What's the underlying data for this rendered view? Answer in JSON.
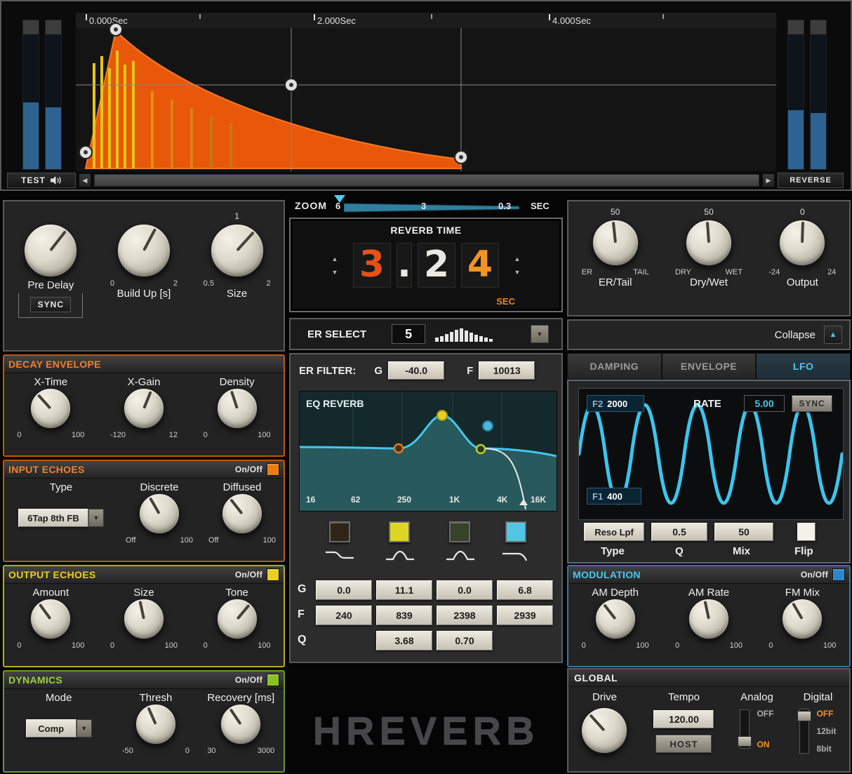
{
  "icons": {
    "up_triangle": "▲",
    "down_triangle": "▼",
    "left_arrow": "◀",
    "right_arrow": "▶"
  },
  "top": {
    "time_labels": [
      "0.000Sec",
      "2.000Sec",
      "4.000Sec"
    ],
    "test": "TEST",
    "reverse": "REVERSE"
  },
  "zoom": {
    "label": "ZOOM",
    "left": "6",
    "mid": "3",
    "right": "0.3",
    "unit": "SEC"
  },
  "left": {
    "pre_delay": {
      "label": "Pre Delay",
      "sync": "SYNC"
    },
    "build_up": {
      "label": "Build Up [s]",
      "min": "0",
      "max": "2"
    },
    "size": {
      "label": "Size",
      "value": "1",
      "min": "0.5",
      "max": "2"
    },
    "decay": {
      "title": "DECAY ENVELOPE",
      "knobs": [
        {
          "label": "X-Time",
          "min": "0",
          "max": "100"
        },
        {
          "label": "X-Gain",
          "min": "-120",
          "max": "12"
        },
        {
          "label": "Density",
          "min": "0",
          "max": "100"
        }
      ]
    },
    "input_echoes": {
      "title": "INPUT ECHOES",
      "onoff": "On/Off",
      "type_label": "Type",
      "type_value": "6Tap 8th FB",
      "knobs": [
        {
          "label": "Discrete",
          "min": "Off",
          "max": "100"
        },
        {
          "label": "Diffused",
          "min": "Off",
          "max": "100"
        }
      ]
    },
    "output_echoes": {
      "title": "OUTPUT ECHOES",
      "onoff": "On/Off",
      "knobs": [
        {
          "label": "Amount",
          "min": "0",
          "max": "100"
        },
        {
          "label": "Size",
          "min": "0",
          "max": "100"
        },
        {
          "label": "Tone",
          "min": "0",
          "max": "100"
        }
      ]
    },
    "dynamics": {
      "title": "DYNAMICS",
      "onoff": "On/Off",
      "mode_label": "Mode",
      "mode_value": "Comp",
      "knobs": [
        {
          "label": "Thresh",
          "min": "-50",
          "max": "0"
        },
        {
          "label": "Recovery [ms]",
          "min": "30",
          "max": "3000"
        }
      ]
    }
  },
  "center": {
    "reverb_time": {
      "title": "REVERB TIME",
      "d1": "3",
      "d2": ".",
      "d3": "2",
      "d4": "4",
      "unit": "SEC"
    },
    "er_select": {
      "label": "ER SELECT",
      "value": "5"
    },
    "er_filter": {
      "label": "ER FILTER:",
      "g": "G",
      "g_value": "-40.0",
      "f": "F",
      "f_value": "10013"
    },
    "eq": {
      "title": "EQ REVERB",
      "freqs": [
        "16",
        "62",
        "250",
        "1K",
        "4K",
        "16K"
      ]
    },
    "grid": {
      "g": "G",
      "f": "F",
      "q": "Q",
      "g_values": [
        "0.0",
        "11.1",
        "0.0",
        "6.8"
      ],
      "f_values": [
        "240",
        "839",
        "2398",
        "2939"
      ],
      "q_values": [
        "3.68",
        "0.70"
      ]
    },
    "logo": "HREVERB"
  },
  "right": {
    "er_tail": {
      "label": "ER/Tail",
      "value": "50",
      "min": "ER",
      "max": "TAIL"
    },
    "dry_wet": {
      "label": "Dry/Wet",
      "value": "50",
      "min": "DRY",
      "max": "WET"
    },
    "output": {
      "label": "Output",
      "value": "0",
      "min": "-24",
      "max": "24"
    },
    "collapse": "Collapse",
    "tabs": [
      "DAMPING",
      "ENVELOPE",
      "LFO"
    ],
    "lfo": {
      "f2": "F2",
      "f2_value": "2000",
      "rate": "RATE",
      "rate_value": "5.00",
      "sync": "SYNC",
      "f1": "F1",
      "f1_value": "400",
      "type_value": "Reso Lpf",
      "q_value": "0.5",
      "mix_value": "50",
      "type": "Type",
      "q": "Q",
      "mix": "Mix",
      "flip": "Flip"
    },
    "modulation": {
      "title": "MODULATION",
      "onoff": "On/Off",
      "knobs": [
        {
          "label": "AM Depth",
          "min": "0",
          "max": "100"
        },
        {
          "label": "AM Rate",
          "min": "0",
          "max": "100"
        },
        {
          "label": "FM Mix",
          "min": "0",
          "max": "100"
        }
      ]
    },
    "global": {
      "title": "GLOBAL",
      "drive": "Drive",
      "tempo": "Tempo",
      "tempo_value": "120.00",
      "host": "HOST",
      "analog": "Analog",
      "analog_off": "OFF",
      "analog_on": "ON",
      "digital": "Digital",
      "digital_off": "OFF",
      "digital_12": "12bit",
      "digital_8": "8bit"
    }
  }
}
